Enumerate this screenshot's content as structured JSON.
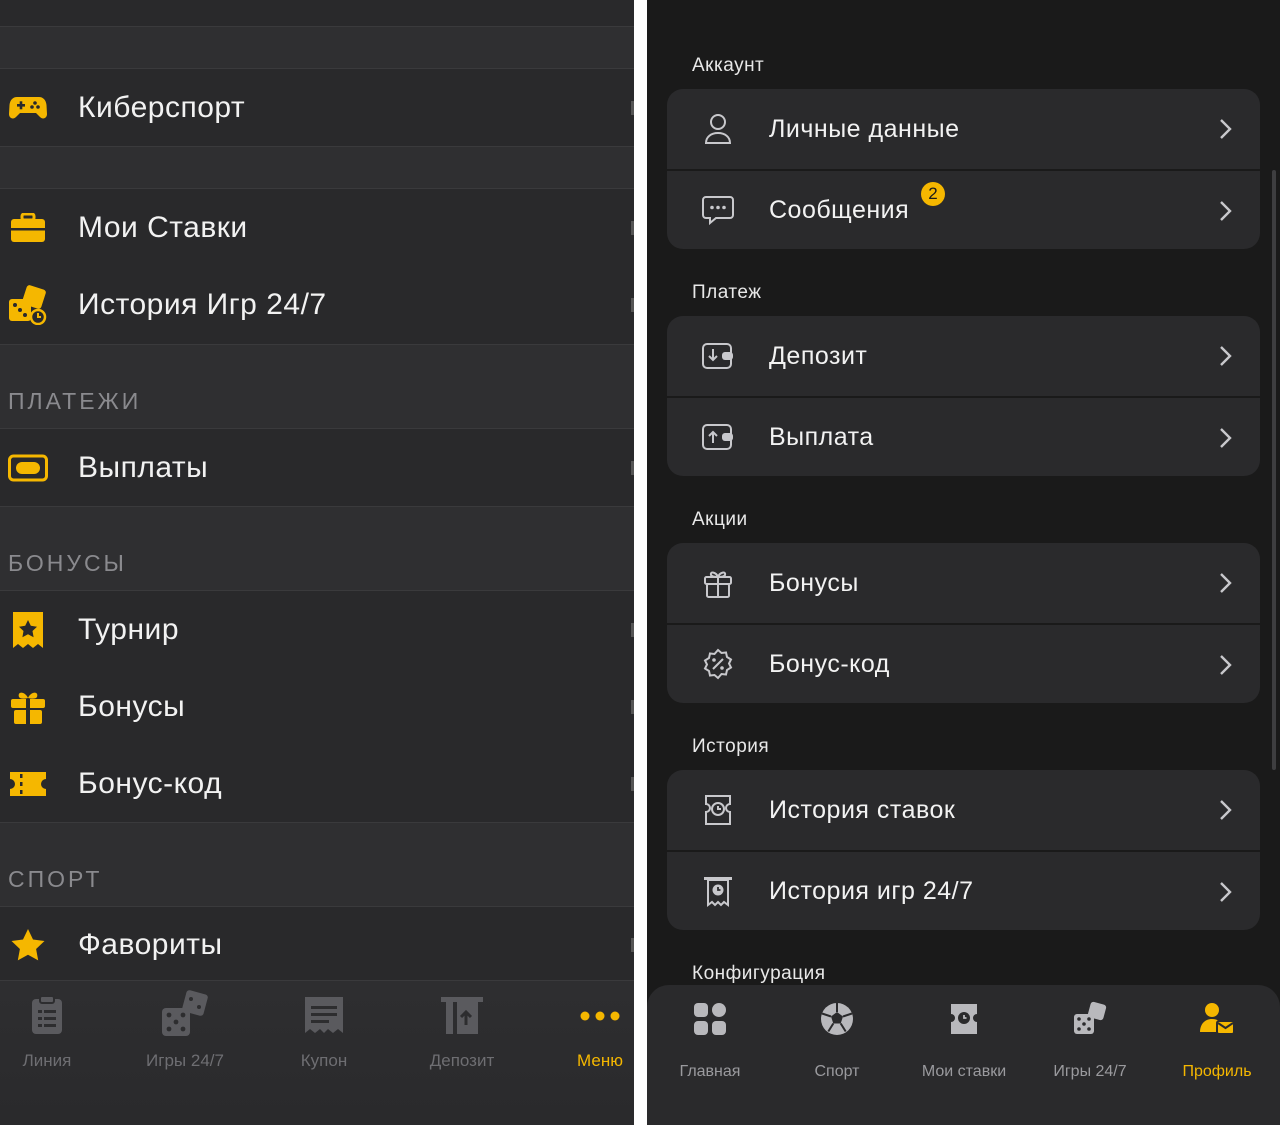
{
  "left": {
    "rows": {
      "esports": "Киберспорт",
      "my_bets": "Мои Ставки",
      "games_history": "История Игр 24/7",
      "payouts": "Выплаты",
      "tournament": "Турнир",
      "bonuses": "Бонусы",
      "bonus_code": "Бонус-код",
      "favorites": "Фавориты"
    },
    "sections": {
      "payments": "ПЛАТЕЖИ",
      "bonuses": "БОНУСЫ",
      "sport": "СПОРТ"
    },
    "tabs": [
      {
        "label": "Линия",
        "icon": "list-icon"
      },
      {
        "label": "Игры 24/7",
        "icon": "dice-icon"
      },
      {
        "label": "Купон",
        "icon": "coupon-icon"
      },
      {
        "label": "Депозит",
        "icon": "deposit-icon"
      },
      {
        "label": "Меню",
        "icon": "more-dots-icon",
        "active": true
      }
    ]
  },
  "right": {
    "sections": {
      "account": "Аккаунт",
      "payment": "Платеж",
      "promos": "Акции",
      "history": "История",
      "config": "Конфигурация"
    },
    "items": {
      "personal": "Личные данные",
      "messages": "Сообщения",
      "messages_badge": "2",
      "deposit": "Депозит",
      "withdraw": "Выплата",
      "bonuses": "Бонусы",
      "bonus_code": "Бонус-код",
      "bet_history": "История ставок",
      "games_history": "История игр 24/7"
    },
    "tabs": [
      {
        "label": "Главная",
        "icon": "grid-icon"
      },
      {
        "label": "Спорт",
        "icon": "soccer-ball-icon"
      },
      {
        "label": "Мои ставки",
        "icon": "ticket-icon"
      },
      {
        "label": "Игры 24/7",
        "icon": "dice-icon"
      },
      {
        "label": "Профиль",
        "icon": "profile-icon",
        "active": true
      }
    ]
  },
  "colors": {
    "accent": "#f5b700",
    "left_bg": "#2b2b2d",
    "right_bg": "#1a1a1a",
    "card_bg": "#2a2a2c"
  }
}
